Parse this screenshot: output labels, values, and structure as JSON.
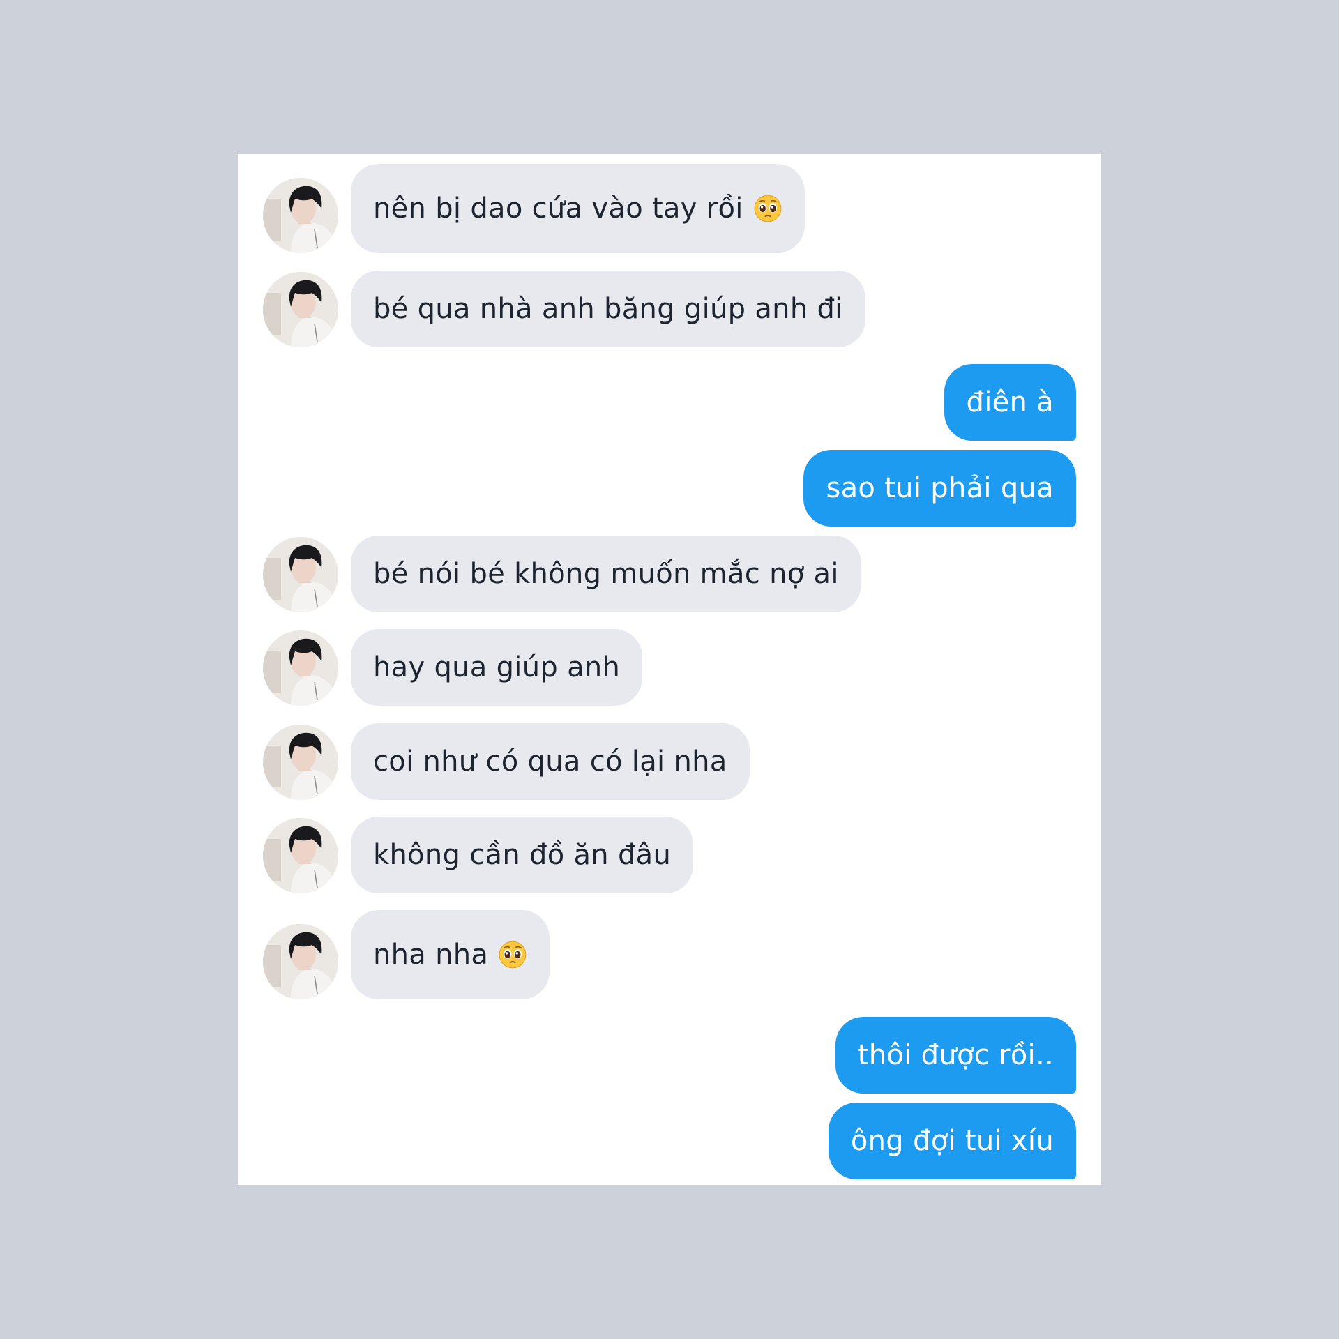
{
  "conversation": {
    "messages": [
      {
        "side": "in",
        "text": "nên bị dao cứa vào tay rồi",
        "emoji": "pleading-face-icon"
      },
      {
        "side": "in",
        "text": "bé qua nhà anh băng giúp anh đi"
      },
      {
        "side": "out",
        "text": "điên à"
      },
      {
        "side": "out",
        "text": "sao tui phải qua"
      },
      {
        "side": "in",
        "text": "bé nói bé không muốn mắc nợ ai"
      },
      {
        "side": "in",
        "text": "hay qua giúp anh"
      },
      {
        "side": "in",
        "text": "coi như có qua có lại nha"
      },
      {
        "side": "in",
        "text": "không cần đồ ăn đâu"
      },
      {
        "side": "in",
        "text": "nha nha",
        "emoji": "pleading-face-icon"
      },
      {
        "side": "out",
        "text": "thôi được rồi.."
      },
      {
        "side": "out",
        "text": "ông đợi tui xíu"
      }
    ]
  },
  "colors": {
    "page_background": "#cdd1da",
    "incoming_bubble": "#e7e9ef",
    "outgoing_bubble": "#1d9bf0"
  }
}
